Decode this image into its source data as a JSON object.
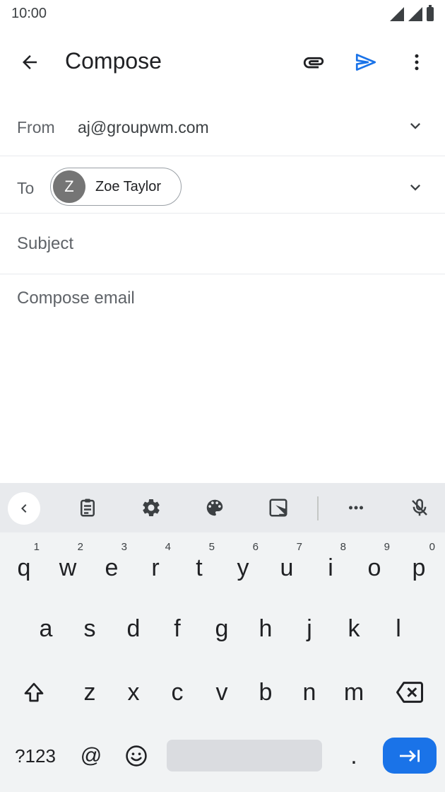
{
  "status_bar": {
    "time": "10:00"
  },
  "app_bar": {
    "title": "Compose"
  },
  "from": {
    "label": "From",
    "value": "aj@groupwm.com"
  },
  "to": {
    "label": "To",
    "recipient": {
      "initial": "Z",
      "name": "Zoe Taylor"
    }
  },
  "subject": {
    "placeholder": "Subject"
  },
  "body": {
    "placeholder": "Compose email"
  },
  "keyboard": {
    "row1": [
      {
        "key": "q",
        "hint": "1"
      },
      {
        "key": "w",
        "hint": "2"
      },
      {
        "key": "e",
        "hint": "3"
      },
      {
        "key": "r",
        "hint": "4"
      },
      {
        "key": "t",
        "hint": "5"
      },
      {
        "key": "y",
        "hint": "6"
      },
      {
        "key": "u",
        "hint": "7"
      },
      {
        "key": "i",
        "hint": "8"
      },
      {
        "key": "o",
        "hint": "9"
      },
      {
        "key": "p",
        "hint": "0"
      }
    ],
    "row2": [
      "a",
      "s",
      "d",
      "f",
      "g",
      "h",
      "j",
      "k",
      "l"
    ],
    "row3": [
      "z",
      "x",
      "c",
      "v",
      "b",
      "n",
      "m"
    ],
    "symbols_label": "?123",
    "at_label": "@",
    "period_label": "."
  },
  "colors": {
    "accent": "#1a73e8",
    "keyboard_bg": "#f1f3f4",
    "toolbar_bg": "#e8eaed"
  }
}
